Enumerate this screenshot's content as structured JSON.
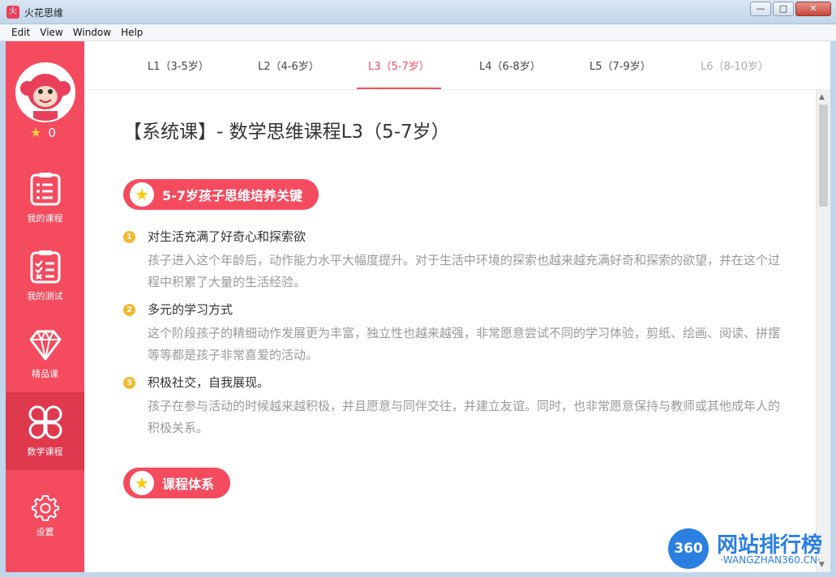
{
  "window": {
    "title": "火花思维",
    "menu": [
      "Edit",
      "View",
      "Window",
      "Help"
    ],
    "buttons": {
      "minimize": "—",
      "maximize": "□",
      "close": "✕"
    }
  },
  "sidebar": {
    "star_count": "0",
    "items": [
      {
        "label": "我的课程",
        "icon": "clipboard-list-icon"
      },
      {
        "label": "我的测试",
        "icon": "checklist-icon"
      },
      {
        "label": "精品课",
        "icon": "diamond-icon"
      },
      {
        "label": "数学课程",
        "icon": "four-petal-icon"
      }
    ],
    "settings_label": "设置"
  },
  "tabs": [
    {
      "label": "L1（3-5岁）",
      "state": "normal"
    },
    {
      "label": "L2（4-6岁）",
      "state": "normal"
    },
    {
      "label": "L3（5-7岁）",
      "state": "active"
    },
    {
      "label": "L4（6-8岁）",
      "state": "normal"
    },
    {
      "label": "L5（7-9岁）",
      "state": "normal"
    },
    {
      "label": "L6（8-10岁）",
      "state": "disabled"
    }
  ],
  "content": {
    "title": "【系统课】- 数学思维课程L3（5-7岁）",
    "section1": "5-7岁孩子思维培养关键",
    "items": [
      {
        "num": "1",
        "heading": "对生活充满了好奇心和探索欲",
        "text": "孩子进入这个年龄后，动作能力水平大幅度提升。对于生活中环境的探索也越来越充满好奇和探索的欲望，并在这个过程中积累了大量的生活经验。"
      },
      {
        "num": "2",
        "heading": "多元的学习方式",
        "text": "这个阶段孩子的精细动作发展更为丰富，独立性也越来越强，非常愿意尝试不同的学习体验，剪纸、绘画、阅读、拼摆等等都是孩子非常喜爱的活动。"
      },
      {
        "num": "3",
        "heading": "积极社交，自我展现。",
        "text": "孩子在参与活动的时候越来越积极，并且愿意与同伴交往，并建立友谊。同时，也非常愿意保持与教师或其他成年人的积极关系。"
      }
    ],
    "section2": "课程体系"
  },
  "watermark": {
    "badge": "360",
    "text": "网站排行榜",
    "sub": "·WANGZHAN360.CN·"
  },
  "colors": {
    "accent": "#f54b5f",
    "star": "#ffc90e",
    "number_badge": "#f5b82e"
  }
}
